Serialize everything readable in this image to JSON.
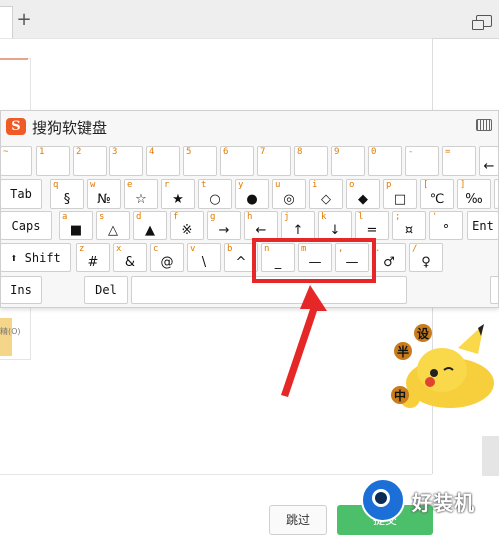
{
  "browser": {
    "new_tab_glyph": "+",
    "window_icon": "restore-window-icon"
  },
  "keyboard": {
    "title": "搜狗软键盘",
    "logo_glyph": "S",
    "logo_color": "#f05a24",
    "rows": [
      [
        {
          "shift": "~",
          "main": ""
        },
        {
          "shift": "1",
          "main": ""
        },
        {
          "shift": "2",
          "main": ""
        },
        {
          "shift": "3",
          "main": ""
        },
        {
          "shift": "4",
          "main": ""
        },
        {
          "shift": "5",
          "main": ""
        },
        {
          "shift": "6",
          "main": ""
        },
        {
          "shift": "7",
          "main": ""
        },
        {
          "shift": "8",
          "main": ""
        },
        {
          "shift": "9",
          "main": ""
        },
        {
          "shift": "0",
          "main": ""
        },
        {
          "shift": "-",
          "main": ""
        },
        {
          "shift": "=",
          "main": ""
        },
        {
          "shift": "",
          "main": "←"
        }
      ],
      [
        {
          "label": "Tab"
        },
        {
          "shift": "q",
          "main": "§"
        },
        {
          "shift": "w",
          "main": "№"
        },
        {
          "shift": "e",
          "main": "☆"
        },
        {
          "shift": "r",
          "main": "★"
        },
        {
          "shift": "t",
          "main": "○"
        },
        {
          "shift": "y",
          "main": "●"
        },
        {
          "shift": "u",
          "main": "◎"
        },
        {
          "shift": "i",
          "main": "◇"
        },
        {
          "shift": "o",
          "main": "◆"
        },
        {
          "shift": "p",
          "main": "□"
        },
        {
          "shift": "[",
          "main": "℃"
        },
        {
          "shift": "]",
          "main": "‰"
        },
        {
          "shift": "",
          "main": ""
        }
      ],
      [
        {
          "label": "Caps"
        },
        {
          "shift": "a",
          "main": "■"
        },
        {
          "shift": "s",
          "main": "△"
        },
        {
          "shift": "d",
          "main": "▲"
        },
        {
          "shift": "f",
          "main": "※"
        },
        {
          "shift": "g",
          "main": "→"
        },
        {
          "shift": "h",
          "main": "←"
        },
        {
          "shift": "j",
          "main": "↑"
        },
        {
          "shift": "k",
          "main": "↓"
        },
        {
          "shift": "l",
          "main": "="
        },
        {
          "shift": ";",
          "main": "¤"
        },
        {
          "shift": "'",
          "main": "°"
        },
        {
          "label": "Ent"
        }
      ],
      [
        {
          "label": "⬆ Shift"
        },
        {
          "shift": "z",
          "main": "#"
        },
        {
          "shift": "x",
          "main": "&"
        },
        {
          "shift": "c",
          "main": "@"
        },
        {
          "shift": "v",
          "main": "\\"
        },
        {
          "shift": "b",
          "main": "^"
        },
        {
          "shift": "n",
          "main": "_"
        },
        {
          "shift": "m",
          "main": "—"
        },
        {
          "shift": ",",
          "main": "—"
        },
        {
          "shift": ".",
          "main": "♂"
        },
        {
          "shift": "/",
          "main": "♀"
        }
      ],
      [
        {
          "label": "Ins"
        },
        {
          "label": "Del"
        },
        {
          "label": ""
        },
        {
          "label": ""
        }
      ]
    ],
    "settings_icon": "keyboard-icon"
  },
  "left_panel": {
    "meta": "精(O)"
  },
  "sticker": {
    "chars": [
      "半",
      "设",
      "中"
    ]
  },
  "buttons": {
    "skip": "跳过",
    "submit": "提交"
  },
  "watermark": {
    "text": "好装机"
  },
  "colors": {
    "highlight": "#e52727",
    "shift_label": "#e07b00",
    "submit": "#4cbf6a"
  }
}
